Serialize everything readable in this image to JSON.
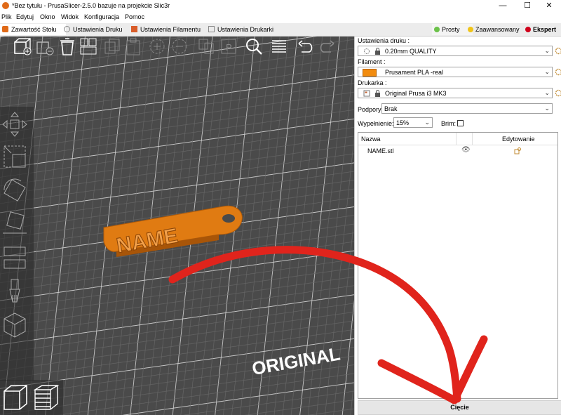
{
  "window": {
    "title": "*Bez tytułu - PrusaSlicer-2.5.0 bazuje na projekcie Slic3r",
    "minimize": "—",
    "maximize": "☐",
    "close": "✕"
  },
  "menu": [
    "Plik",
    "Edytuj",
    "Okno",
    "Widok",
    "Konfiguracja",
    "Pomoc"
  ],
  "tabs": [
    "Zawartość Stołu",
    "Ustawienia Druku",
    "Ustawienia Filamentu",
    "Ustawienia Drukarki"
  ],
  "modes": [
    {
      "label": "Prosty",
      "color": "#6cc24a"
    },
    {
      "label": "Zaawansowany",
      "color": "#f0c419"
    },
    {
      "label": "Ekspert",
      "color": "#d0021b"
    }
  ],
  "scene": {
    "object_label": "NAME",
    "bed_label": "ORIGINAL",
    "object_color": "#e07b12"
  },
  "panel": {
    "print_settings_label": "Ustawienia druku :",
    "print_settings_value": "0.20mm QUALITY",
    "filament_label": "Filament :",
    "filament_value": "Prusament PLA -real",
    "filament_color": "#f28c0f",
    "printer_label": "Drukarka :",
    "printer_value": "Original Prusa i3 MK3",
    "supports_label": "Podpory:",
    "supports_value": "Brak",
    "infill_label": "Wypełnienie:",
    "infill_value": "15%",
    "brim_label": "Brim:",
    "col_name": "Nazwa",
    "col_edit": "Edytowanie",
    "objects": [
      {
        "name": "NAME.stl"
      }
    ],
    "slice_label": "Cięcie"
  }
}
